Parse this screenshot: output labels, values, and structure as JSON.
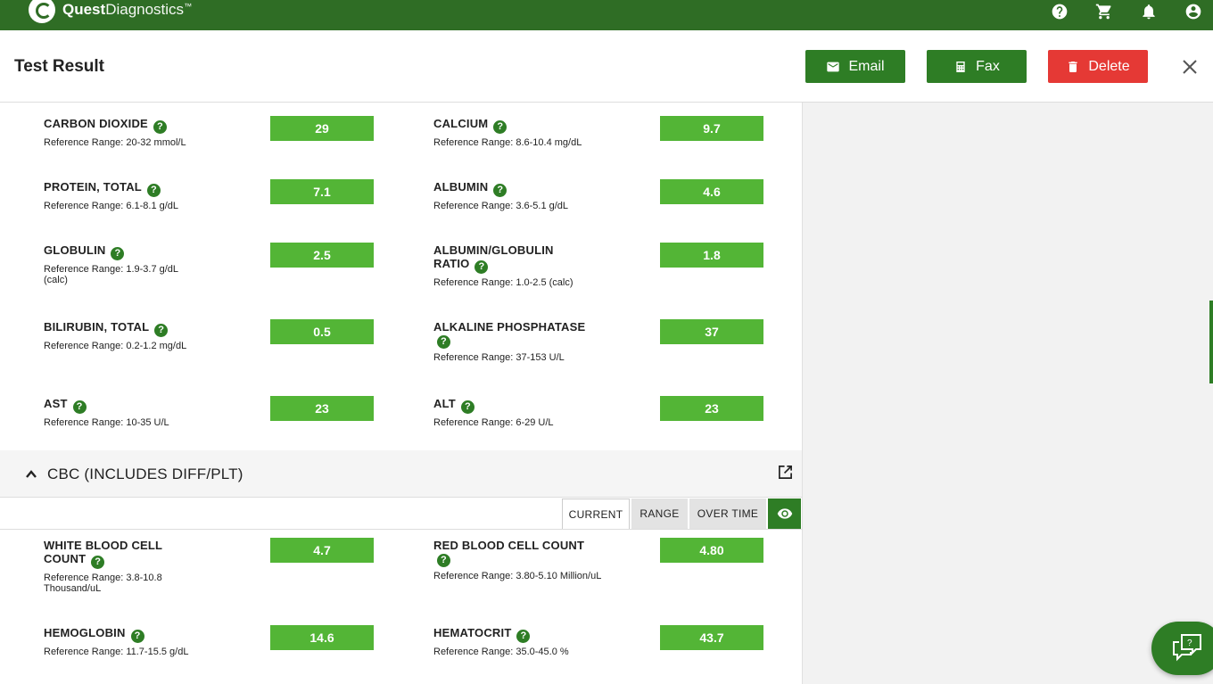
{
  "brand": {
    "name_bold": "Quest",
    "name_light": "Diagnostics",
    "trademark": "™"
  },
  "header": {
    "title": "Test Result",
    "email_label": "Email",
    "fax_label": "Fax",
    "delete_label": "Delete"
  },
  "results_top": [
    {
      "name": "CARBON DIOXIDE",
      "ref": "Reference Range: 20-32 mmol/L",
      "value": "29"
    },
    {
      "name": "CALCIUM",
      "ref": "Reference Range: 8.6-10.4 mg/dL",
      "value": "9.7"
    },
    {
      "name": "PROTEIN, TOTAL",
      "ref": "Reference Range: 6.1-8.1 g/dL",
      "value": "7.1"
    },
    {
      "name": "ALBUMIN",
      "ref": "Reference Range: 3.6-5.1 g/dL",
      "value": "4.6"
    },
    {
      "name": "GLOBULIN",
      "ref": "Reference Range: 1.9-3.7 g/dL (calc)",
      "value": "2.5"
    },
    {
      "name": "ALBUMIN/GLOBULIN RATIO",
      "ref": "Reference Range: 1.0-2.5 (calc)",
      "value": "1.8"
    },
    {
      "name": "BILIRUBIN, TOTAL",
      "ref": "Reference Range: 0.2-1.2 mg/dL",
      "value": "0.5"
    },
    {
      "name": "ALKALINE PHOSPHATASE",
      "ref": "Reference Range: 37-153 U/L",
      "value": "37"
    },
    {
      "name": "AST",
      "ref": "Reference Range: 10-35 U/L",
      "value": "23"
    },
    {
      "name": "ALT",
      "ref": "Reference Range: 6-29 U/L",
      "value": "23"
    }
  ],
  "cbc": {
    "title": "CBC (INCLUDES DIFF/PLT)",
    "tabs": {
      "current": "CURRENT",
      "range": "RANGE",
      "over_time": "OVER TIME"
    },
    "results": [
      {
        "name": "WHITE BLOOD CELL COUNT",
        "ref": "Reference Range: 3.8-10.8 Thousand/uL",
        "value": "4.7"
      },
      {
        "name": "RED BLOOD CELL COUNT",
        "ref": "Reference Range: 3.80-5.10 Million/uL",
        "value": "4.80"
      },
      {
        "name": "HEMOGLOBIN",
        "ref": "Reference Range: 11.7-15.5 g/dL",
        "value": "14.6"
      },
      {
        "name": "HEMATOCRIT",
        "ref": "Reference Range: 35.0-45.0 %",
        "value": "43.7"
      }
    ]
  },
  "help_glyph": "?",
  "icons": [
    "help-circle-icon",
    "cart-icon",
    "bell-icon",
    "account-icon",
    "mail-icon",
    "fax-icon",
    "trash-icon",
    "close-icon",
    "chevron-up-icon",
    "external-link-icon",
    "eye-icon",
    "chat-help-icon"
  ],
  "colors": {
    "brand_green": "#2f6d25",
    "value_green": "#53b536",
    "delete_red": "#e53935"
  }
}
